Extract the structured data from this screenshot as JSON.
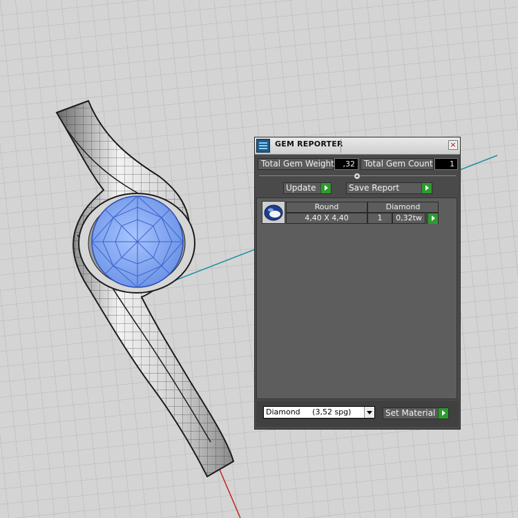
{
  "panel": {
    "title": "GEM REPORTER",
    "close_glyph": "×",
    "total_weight_label": "Total Gem Weight",
    "total_weight_value": ",32",
    "total_count_label": "Total Gem Count",
    "total_count_value": "1",
    "update_label": "Update",
    "save_report_label": "Save Report",
    "table": {
      "columns": [
        "Round",
        "Diamond"
      ],
      "rows": [
        {
          "size": "4,40 X 4,40",
          "count": "1",
          "weight": "0,32tw"
        }
      ]
    },
    "material_select": {
      "name": "Diamond",
      "spg": "(3,52 spg)"
    },
    "set_material_label": "Set Material"
  },
  "colors": {
    "panel_bg": "#4a4a4a",
    "accent_green": "#2f9a2f",
    "gem_blue": "#7fa6f0",
    "axis_cyan": "#1a8fa0",
    "axis_red": "#c0201a"
  },
  "icons": [
    "gem-reporter-icon",
    "close-icon",
    "play-icon",
    "gem-icon",
    "dropdown-arrow-icon"
  ]
}
